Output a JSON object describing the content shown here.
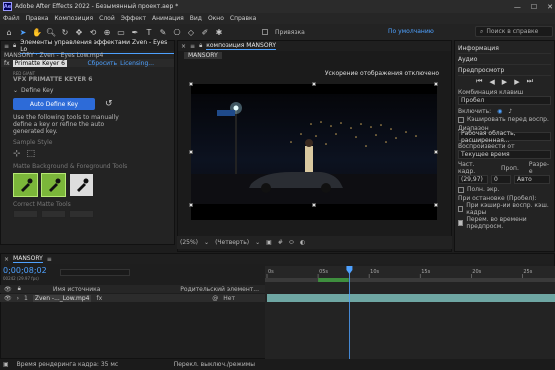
{
  "window": {
    "title": "Adobe After Effects 2022 - Безымянный проект.aep *",
    "controls": [
      "—",
      "☐",
      "✕"
    ]
  },
  "menu": [
    "Файл",
    "Правка",
    "Композиция",
    "Слой",
    "Эффект",
    "Анимация",
    "Вид",
    "Окно",
    "Справка"
  ],
  "toolbar": {
    "snap_label": "Привязка",
    "workspace": "По умолчанию",
    "search_placeholder": "Поиск в справке"
  },
  "effects_panel": {
    "tab_label": "Элементы управления эффектами Zven - Eyes Lo",
    "layer_path": "MANSORY · Zven - Eyes Low.mp4",
    "effect_name": "Primatte Keyer 6",
    "reset": "Сбросить",
    "licensing": "Licensing...",
    "brand": "RED GIANT",
    "product": "VFX PRIMATTE KEYER 6",
    "define_key": "Define Key",
    "auto_define": "Auto Define Key",
    "help_text": "Use the following tools to manually define a key or refine the auto generated key.",
    "sample_style": "Sample Style",
    "matte_tools": "Matte Background & Foreground Tools",
    "correct_tools": "Correct Matte Tools"
  },
  "comp_panel": {
    "tab_label": "композиция MANSORY",
    "sub_tab": "MANSORY",
    "accel_notice": "Ускорение отображения отключено",
    "zoom": "(25%)",
    "resolution": "(Четверть)"
  },
  "right_panel": {
    "info": "Информация",
    "audio": "Аудио",
    "preview": "Предпросмотр",
    "shortcut_label": "Комбинация клавиш",
    "shortcut_value": "Пробел",
    "include_label": "Включить:",
    "cache_label": "Кэшировать перед воспр.",
    "range_label": "Диапазон",
    "range_value": "Рабочая область, расширенная...",
    "play_from_label": "Воспроизвести от",
    "play_from_value": "Текущее время",
    "fps_label": "Част. кадр.",
    "skip_label": "Проп.",
    "res_label": "Разре-е",
    "fps_value": "(29,97)",
    "skip_value": "0",
    "res_value": "Авто",
    "fullscreen_label": "Полн. экр.",
    "on_stop_label": "При остановке (Пробел):",
    "cache_stop_label": "При кэшир-ии воспр. кэш. кадры",
    "move_time_label": "Перем. во времени предпросм."
  },
  "timeline": {
    "tab_label": "MANSORY",
    "timecode": "0;00;08;02",
    "frames": "00242 (29.97 fps)",
    "col_source": "Имя источника",
    "col_parent": "Родительский элемент...",
    "layer_index": "1",
    "layer_name": "Zven -..._Low.mp4",
    "parent_value": "Нет",
    "ruler": [
      "0s",
      "05s",
      "10s",
      "15s",
      "20s",
      "25s"
    ],
    "playhead_position": 8.07,
    "duration_seconds": 28
  },
  "status": {
    "render_time": "Время рендеринга кадра: 35 мс",
    "toggle": "Перекл. выключ./режимы"
  },
  "colors": {
    "accent": "#4ea1ff",
    "layer_bar": "#6ea6a3",
    "tool_active": "#7bb63a"
  }
}
